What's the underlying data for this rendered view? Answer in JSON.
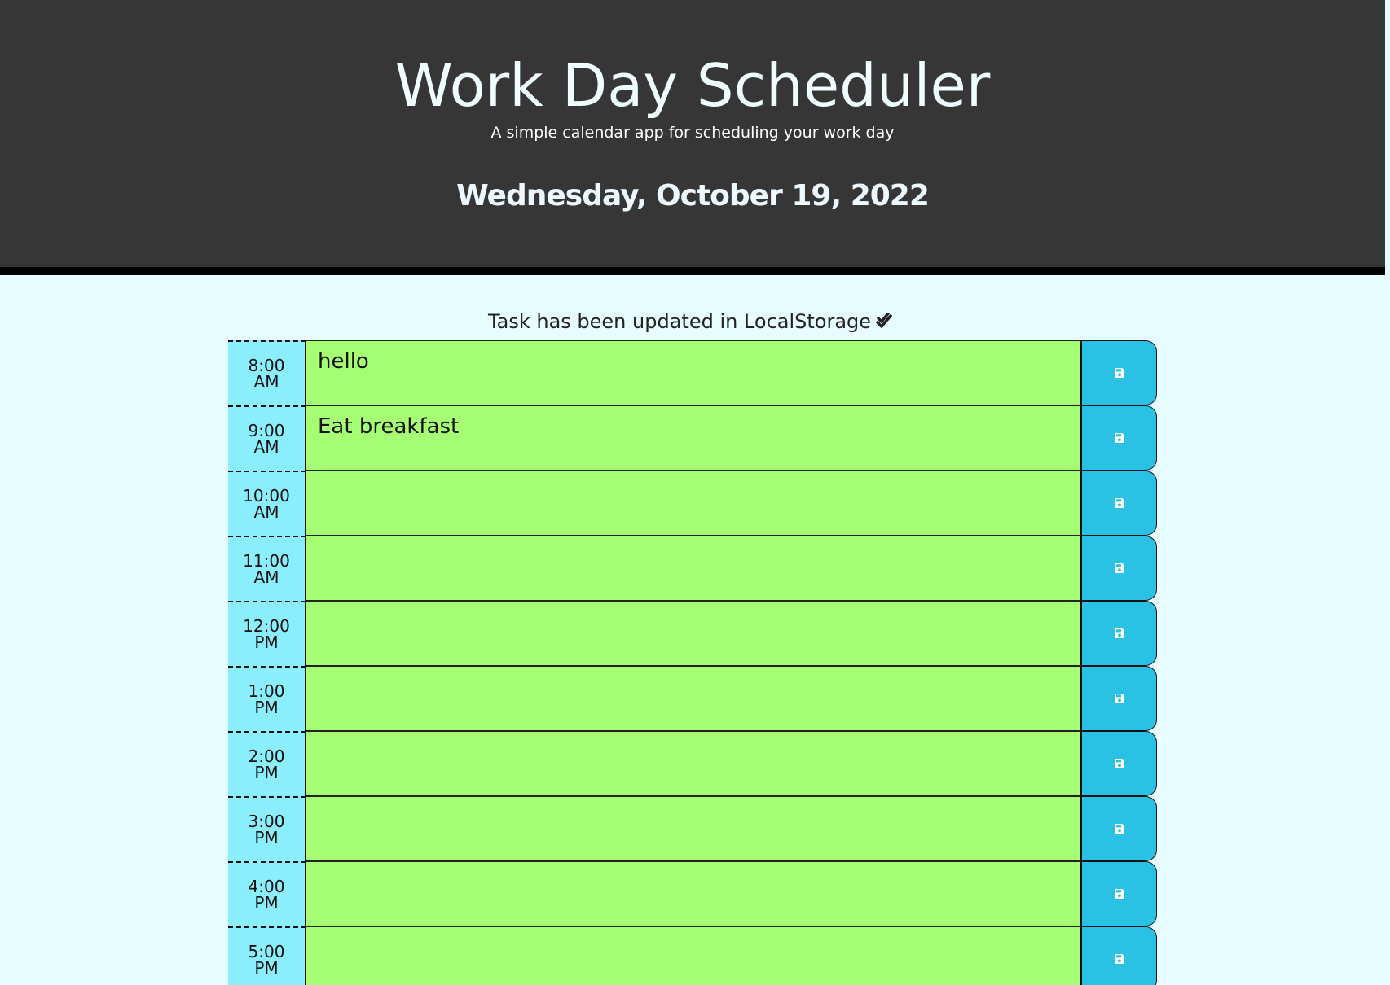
{
  "header": {
    "title": "Work Day Scheduler",
    "subtitle": "A simple calendar app for scheduling your work day",
    "current_date": "Wednesday, October 19, 2022"
  },
  "status": {
    "message": "Task has been updated in LocalStorage",
    "icon": "double-check-icon"
  },
  "colors": {
    "header_bg": "#363636",
    "page_bg": "#e7fcfe",
    "hour_bg": "#8aeefc",
    "future_task_bg": "#a6fe74",
    "save_button_bg": "#29c2e4"
  },
  "save_icon": "floppy-disk-icon",
  "time_blocks": [
    {
      "time": "8:00",
      "period": "AM",
      "task": "hello"
    },
    {
      "time": "9:00",
      "period": "AM",
      "task": "Eat breakfast"
    },
    {
      "time": "10:00",
      "period": "AM",
      "task": ""
    },
    {
      "time": "11:00",
      "period": "AM",
      "task": ""
    },
    {
      "time": "12:00",
      "period": "PM",
      "task": ""
    },
    {
      "time": "1:00",
      "period": "PM",
      "task": ""
    },
    {
      "time": "2:00",
      "period": "PM",
      "task": ""
    },
    {
      "time": "3:00",
      "period": "PM",
      "task": ""
    },
    {
      "time": "4:00",
      "period": "PM",
      "task": ""
    },
    {
      "time": "5:00",
      "period": "PM",
      "task": ""
    }
  ]
}
